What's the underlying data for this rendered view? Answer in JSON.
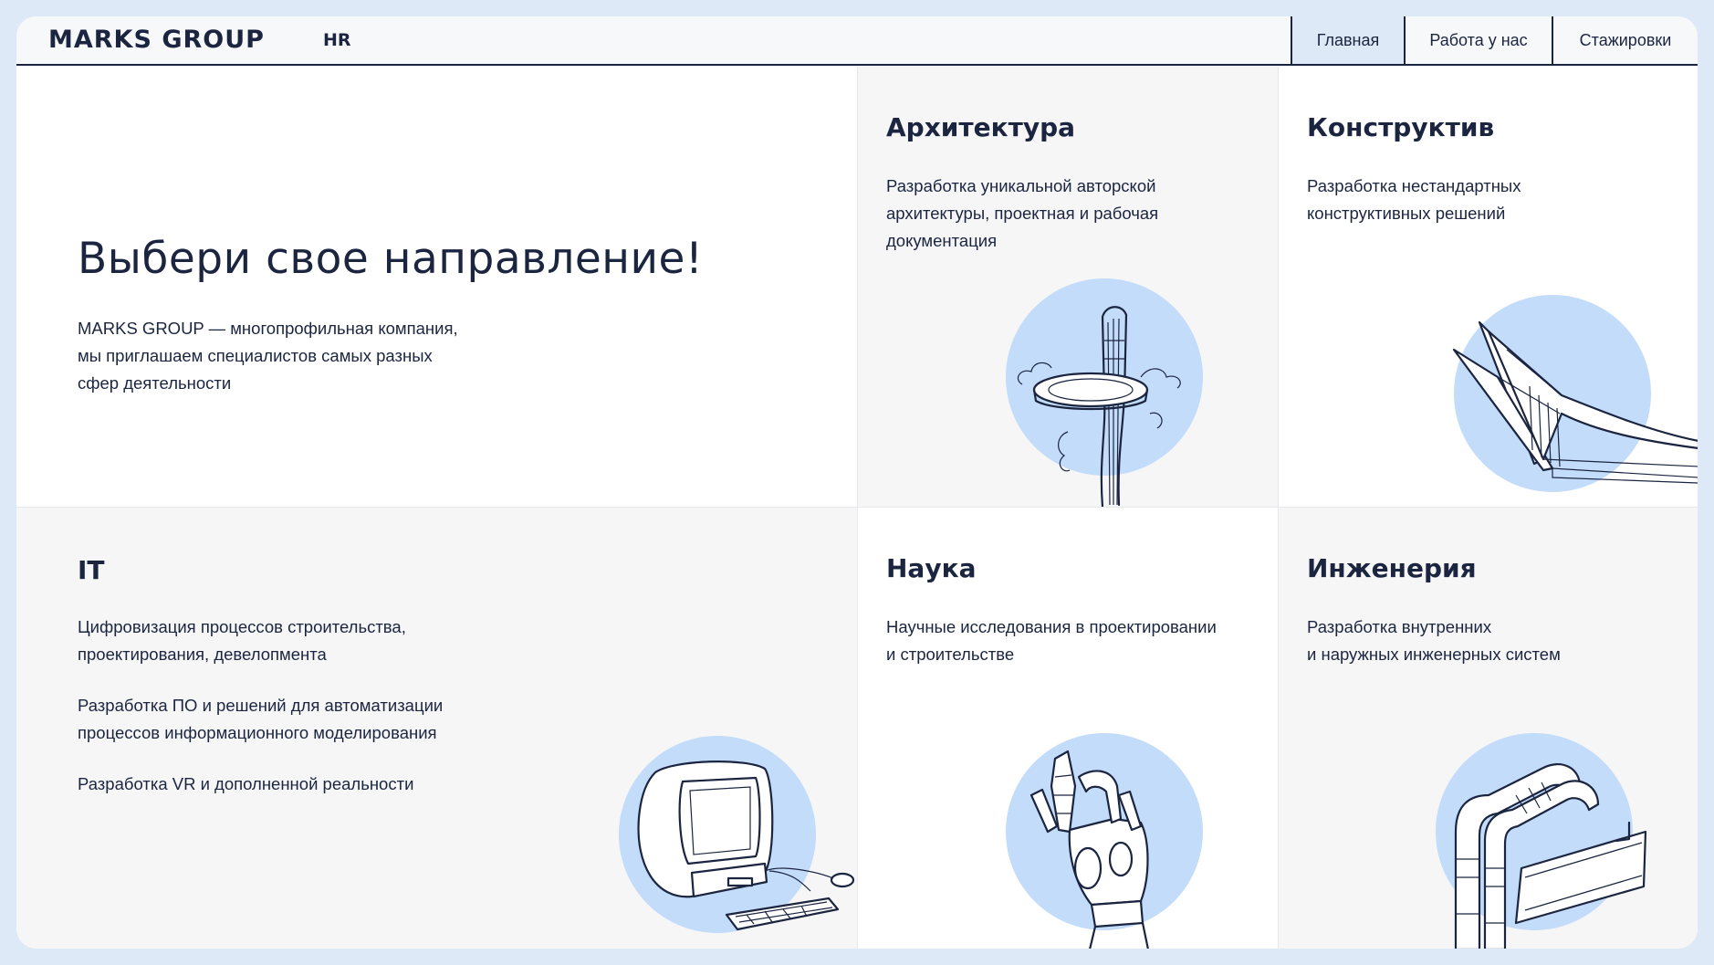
{
  "header": {
    "logo": "MARKS GROUP",
    "logo_suffix": "HR",
    "nav": [
      {
        "label": "Главная",
        "active": true
      },
      {
        "label": "Работа у нас",
        "active": false
      },
      {
        "label": "Стажировки",
        "active": false
      }
    ]
  },
  "hero": {
    "title": "Выбери свое направление!",
    "lines": [
      "MARKS GROUP — многопрофильная компания,",
      "мы приглашаем специалистов самых разных",
      "сфер деятельности"
    ]
  },
  "cards": {
    "architecture": {
      "title": "Архитектура",
      "lines": [
        "Разработка уникальной авторской",
        "архитектуры, проектная и рабочая",
        "документация"
      ],
      "icon": "tower-illustration"
    },
    "konstruktiv": {
      "title": "Конструктив",
      "lines": [
        "Разработка нестандартных",
        "конструктивных решений"
      ],
      "icon": "structure-illustration"
    },
    "it": {
      "title": "IT",
      "paragraphs": [
        [
          "Цифровизация процессов строительства,",
          "проектирования, девелопмента"
        ],
        [
          "Разработка ПО и решений для автоматизации",
          "процессов информационного моделирования"
        ],
        [
          "Разработка VR и дополненной реальности"
        ]
      ],
      "icon": "computer-illustration"
    },
    "nauka": {
      "title": "Наука",
      "lines": [
        "Научные исследования в проектировании",
        "и строительстве"
      ],
      "icon": "robot-hand-illustration"
    },
    "ingeneria": {
      "title": "Инженерия",
      "lines": [
        "Разработка внутренних",
        "и наружных инженерных систем"
      ],
      "icon": "pipes-illustration"
    }
  },
  "colors": {
    "background": "#dde9f6",
    "ink": "#1b2540",
    "accent_circle": "#c3dcfa",
    "card_gray": "#f6f6f7"
  }
}
